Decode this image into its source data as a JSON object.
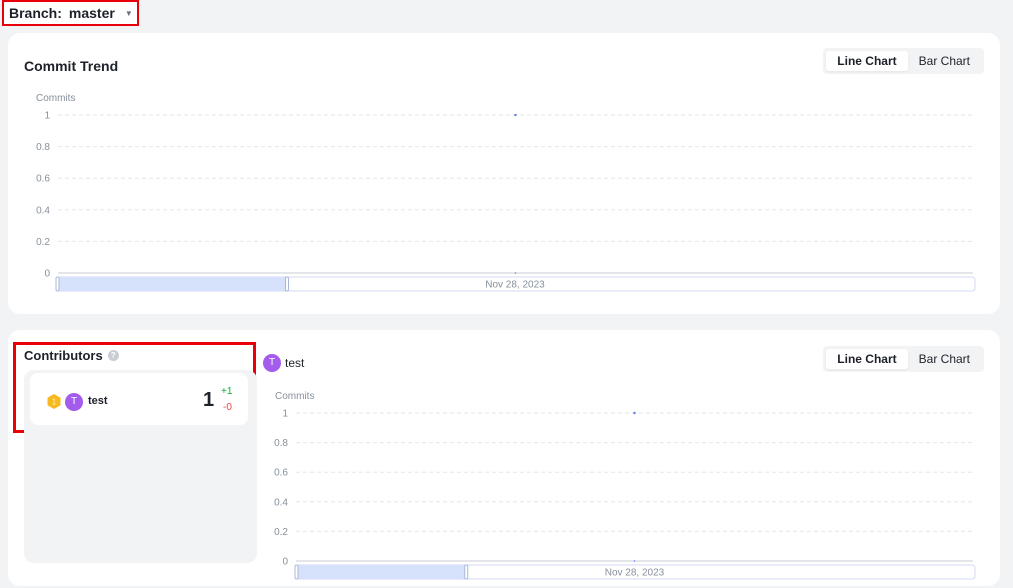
{
  "branch": {
    "label": "Branch:",
    "value": "master"
  },
  "trend": {
    "title": "Commit Trend",
    "toggle": {
      "line": "Line Chart",
      "bar": "Bar Chart",
      "active": "line"
    },
    "chart_data": {
      "type": "line",
      "ylabel": "Commits",
      "yticks": [
        "1",
        "0.8",
        "0.6",
        "0.4",
        "0.2",
        "0"
      ],
      "ylim": [
        0,
        1
      ],
      "x": [
        "Nov 28, 2023"
      ],
      "series": [
        {
          "values": [
            1
          ]
        }
      ],
      "grid": true,
      "slider_label": "Nov 28, 2023"
    }
  },
  "contributors": {
    "title": "Contributors",
    "info_icon": "info-icon",
    "items": [
      {
        "avatar": "T",
        "name": "test",
        "commits": "1",
        "additions": "+1",
        "deletions": "-0",
        "medal": "gold-medal-icon"
      }
    ],
    "selected": {
      "avatar": "T",
      "name": "test"
    },
    "toggle": {
      "line": "Line Chart",
      "bar": "Bar Chart",
      "active": "line"
    },
    "chart_data": {
      "type": "line",
      "ylabel": "Commits",
      "yticks": [
        "1",
        "0.8",
        "0.6",
        "0.4",
        "0.2",
        "0"
      ],
      "ylim": [
        0,
        1
      ],
      "x": [
        "Nov 28, 2023"
      ],
      "series": [
        {
          "values": [
            1
          ]
        }
      ],
      "grid": true,
      "slider_label": "Nov 28, 2023"
    }
  },
  "colors": {
    "highlight": "#e8000b",
    "avatar": "#a35ceb",
    "series": "#5b7cf7",
    "additions": "#00b42a",
    "deletions": "#f53f3f",
    "slider_fill": "#d6e2fb"
  }
}
